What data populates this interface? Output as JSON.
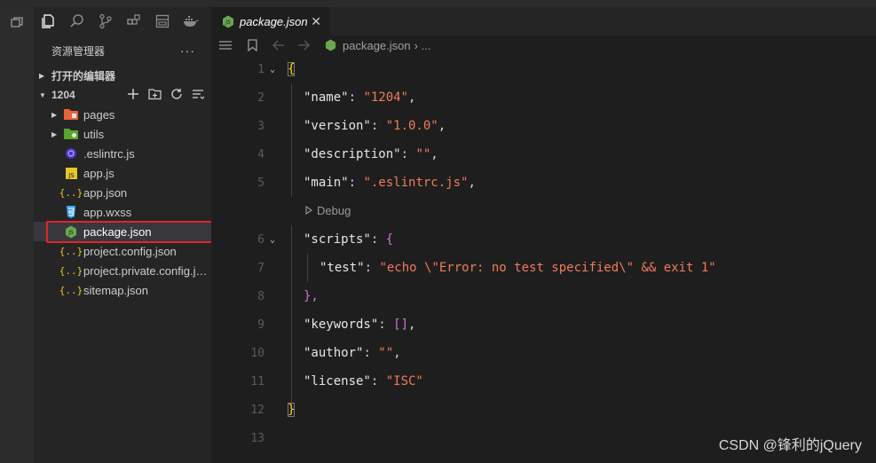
{
  "colors": {
    "accent": "#ffd700",
    "string": "#f07b5c",
    "highlight": "#e0262a"
  },
  "explorer": {
    "title": "资源管理器",
    "more": "···",
    "open_editors": "打开的编辑器",
    "root": "1204",
    "items": [
      {
        "name": "pages",
        "icon": "folder-pages-icon"
      },
      {
        "name": "utils",
        "icon": "folder-utils-icon"
      },
      {
        "name": ".eslintrc.js",
        "icon": "eslint-icon"
      },
      {
        "name": "app.js",
        "icon": "js-file-icon"
      },
      {
        "name": "app.json",
        "icon": "json-file-icon"
      },
      {
        "name": "app.wxss",
        "icon": "css-file-icon"
      },
      {
        "name": "package.json",
        "icon": "node-icon"
      },
      {
        "name": "project.config.json",
        "icon": "json-file-icon"
      },
      {
        "name": "project.private.config.js...",
        "icon": "json-file-icon"
      },
      {
        "name": "sitemap.json",
        "icon": "json-file-icon"
      }
    ]
  },
  "tab": {
    "title": "package.json",
    "close": "✕"
  },
  "breadcrumb": {
    "file": "package.json",
    "sep": "› ..."
  },
  "editor": {
    "codelens": "Debug",
    "lines": {
      "l1": {
        "num": "1",
        "text": "{"
      },
      "l2": {
        "num": "2",
        "k": "\"name\"",
        "v": "\"1204\""
      },
      "l3": {
        "num": "3",
        "k": "\"version\"",
        "v": "\"1.0.0\""
      },
      "l4": {
        "num": "4",
        "k": "\"description\"",
        "v": "\"\""
      },
      "l5": {
        "num": "5",
        "k": "\"main\"",
        "v": "\".eslintrc.js\""
      },
      "l6": {
        "num": "6",
        "k": "\"scripts\"",
        "v": "{"
      },
      "l7": {
        "num": "7",
        "k": "\"test\"",
        "v": "\"echo \\\"Error: no test specified\\\" && exit 1\""
      },
      "l8": {
        "num": "8",
        "text": "},"
      },
      "l9": {
        "num": "9",
        "k": "\"keywords\"",
        "v": "[]"
      },
      "l10": {
        "num": "10",
        "k": "\"author\"",
        "v": "\"\""
      },
      "l11": {
        "num": "11",
        "k": "\"license\"",
        "v": "\"ISC\""
      },
      "l12": {
        "num": "12",
        "text": "}"
      },
      "l13": {
        "num": "13"
      }
    }
  },
  "watermark": "CSDN @锋利的jQuery"
}
